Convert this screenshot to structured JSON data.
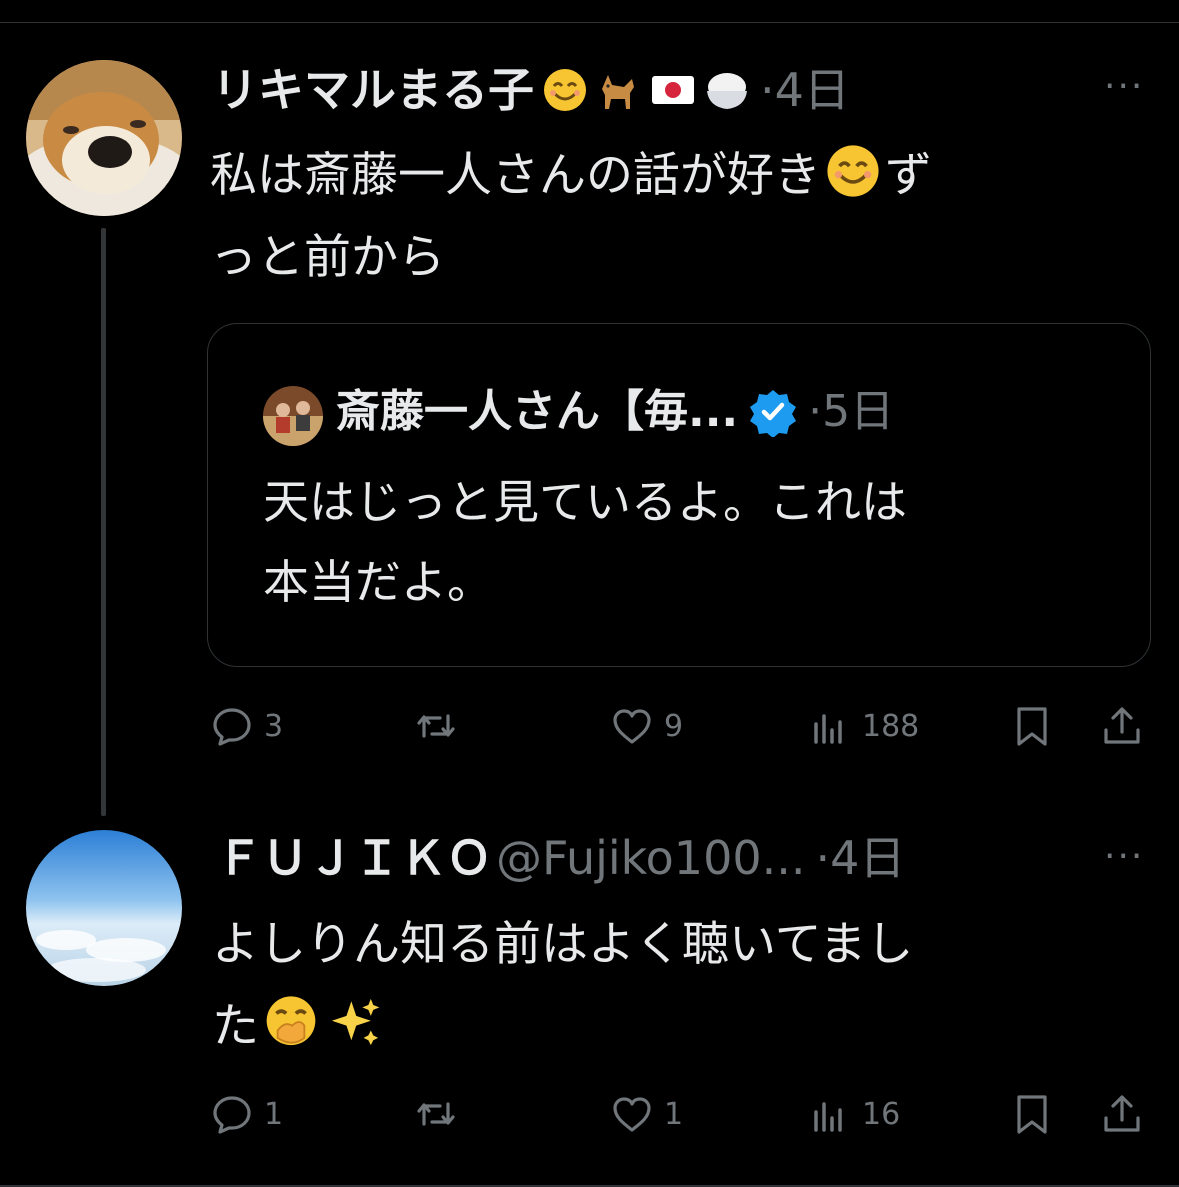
{
  "tweets": [
    {
      "name": "リキマルまる子",
      "name_emojis": [
        "smiling-face-emoji",
        "dog-emoji",
        "japan-flag-emoji",
        "rice-bowl-emoji"
      ],
      "time": "4日",
      "separator": "·",
      "more": "···",
      "text_line1": "私は斎藤一人さんの話が好き",
      "text_line1_end": "ず",
      "text_line2": "っと前から",
      "quote": {
        "name": "斎藤一人さん【毎...",
        "time": "5日",
        "text_line1": "天はじっと見ているよ。これは",
        "text_line2": "本当だよ。"
      },
      "actions": {
        "replies": "3",
        "retweets": "",
        "likes": "9",
        "views": "188"
      }
    },
    {
      "name": "ＦＵＪＩＫＯ",
      "handle": "@Fujiko100...",
      "time": "4日",
      "separator": "·",
      "more": "···",
      "text_line1": "よしりん知る前はよく聴いてまし",
      "text_line2": "た",
      "actions": {
        "replies": "1",
        "retweets": "",
        "likes": "1",
        "views": "16"
      }
    }
  ],
  "colors": {
    "background": "#000000",
    "text": "#e7e9ea",
    "muted": "#71767b",
    "verified": "#1d9bf0",
    "border": "#2f3336"
  }
}
